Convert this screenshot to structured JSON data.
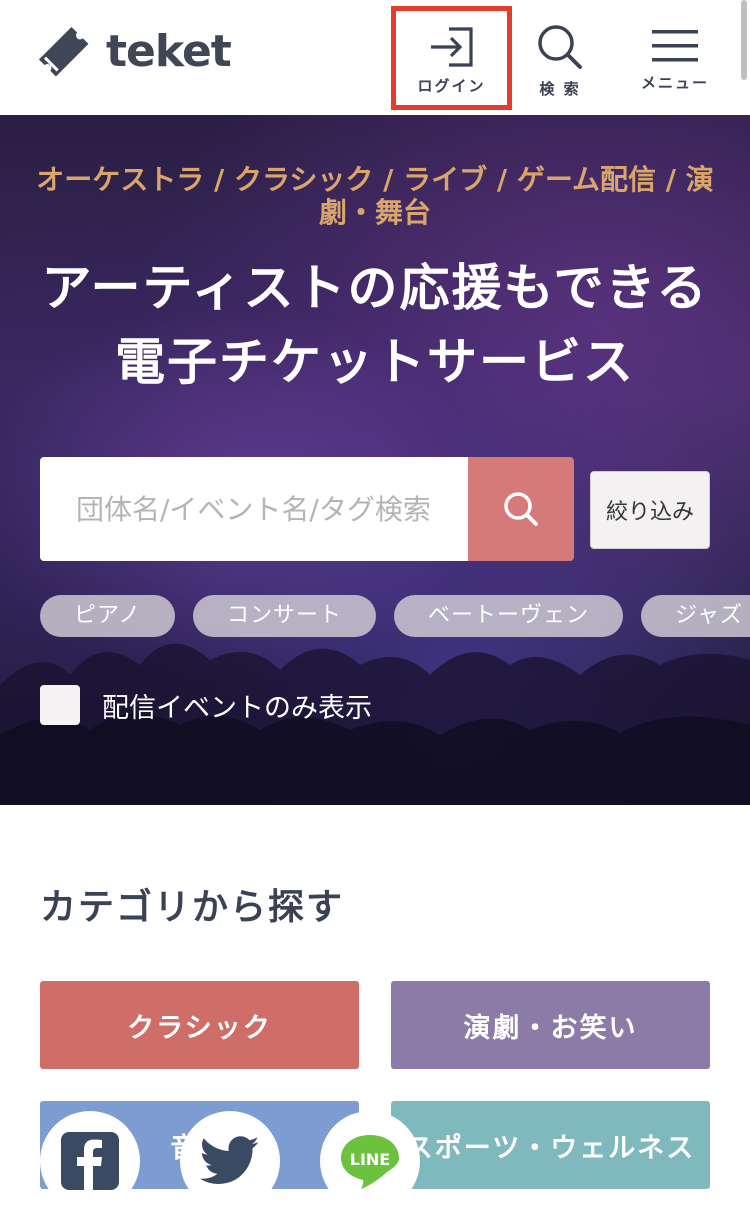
{
  "header": {
    "logo_text": "teket",
    "login_label": "ログイン",
    "search_label": "検 索",
    "menu_label": "メニュー"
  },
  "hero": {
    "genres": "オーケストラ / クラシック / ライブ / ゲーム配信 / 演劇・舞台",
    "headline_line1": "アーティストの応援もできる",
    "headline_line2": "電子チケットサービス",
    "search_placeholder": "団体名/イベント名/タグ検索",
    "filter_label": "絞り込み",
    "tags": [
      "ピアノ",
      "コンサート",
      "ベートーヴェン",
      "ジャズ"
    ],
    "online_only_label": "配信イベントのみ表示"
  },
  "categories": {
    "title": "カテゴリから探す",
    "items": [
      {
        "label": "クラシック",
        "color": "#cf6e68"
      },
      {
        "label": "演劇・お笑い",
        "color": "#8c7ba6"
      },
      {
        "label": "音楽",
        "color": "#7d9cd1"
      },
      {
        "label": "スポーツ・ウェルネス",
        "color": "#7fb9be"
      }
    ]
  },
  "social": {
    "line_text": "LINE"
  },
  "colors": {
    "accent": "#d57a78",
    "genre_text": "#d9a56a",
    "highlight": "#e23d2e"
  }
}
